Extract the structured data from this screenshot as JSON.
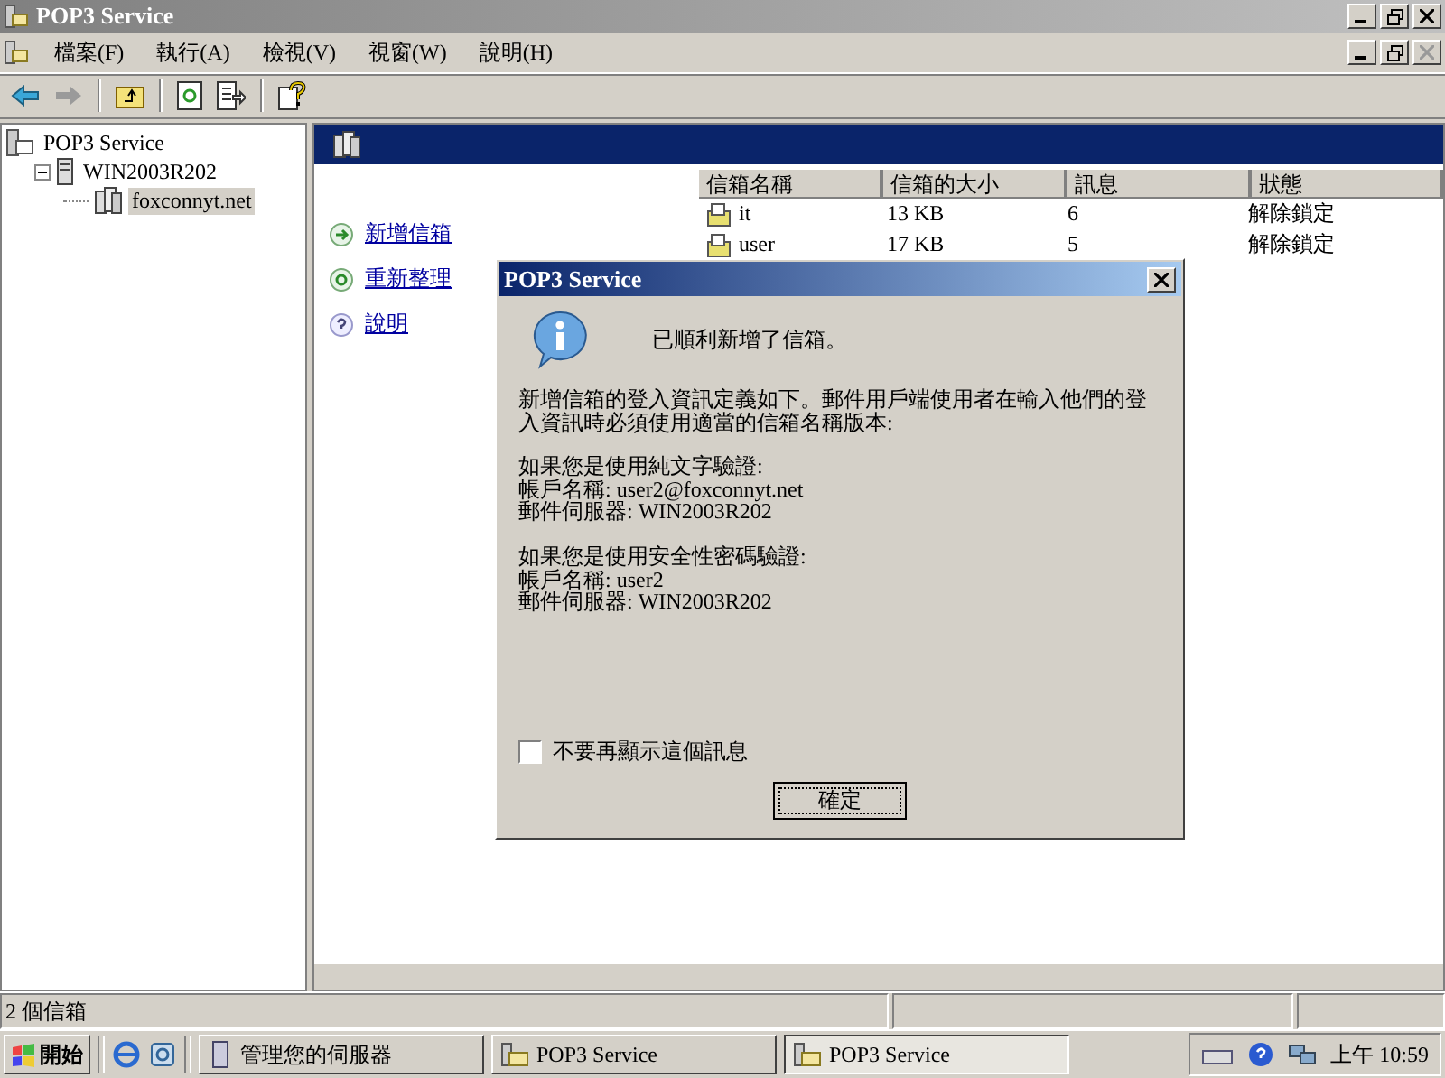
{
  "window": {
    "title": "POP3 Service"
  },
  "menu": [
    "檔案(F)",
    "執行(A)",
    "檢視(V)",
    "視窗(W)",
    "說明(H)"
  ],
  "tree": [
    {
      "label": "POP3 Service",
      "selected": false,
      "kind": "service",
      "children": [
        {
          "label": "WIN2003R202",
          "selected": false,
          "kind": "server",
          "expanded": true,
          "children": [
            {
              "label": "foxconnyt.net",
              "selected": true,
              "kind": "domain"
            }
          ]
        }
      ]
    }
  ],
  "actions": [
    {
      "label": "新增信箱",
      "kind": "add"
    },
    {
      "label": "重新整理",
      "kind": "refresh"
    },
    {
      "label": "說明",
      "kind": "help"
    }
  ],
  "table": {
    "columns": [
      "信箱名稱",
      "信箱的大小",
      "訊息",
      "狀態"
    ],
    "rows": [
      {
        "cells": [
          "it",
          "13 KB",
          "6",
          "解除鎖定"
        ]
      },
      {
        "cells": [
          "user",
          "17 KB",
          "5",
          "解除鎖定"
        ]
      }
    ]
  },
  "dialog": {
    "title": "POP3 Service",
    "heading": "已順利新增了信箱。",
    "sections": [
      [
        "新增信箱的登入資訊定義如下。郵件用戶端使用者在輸入他們的登入資訊時必須使用適當的信箱名稱版本:"
      ],
      [
        "如果您是使用純文字驗證:",
        "帳戶名稱: user2@foxconnyt.net",
        "郵件伺服器: WIN2003R202"
      ],
      [
        "如果您是使用安全性密碼驗證:",
        "帳戶名稱: user2",
        "郵件伺服器: WIN2003R202"
      ]
    ],
    "checkbox": {
      "label": "不要再顯示這個訊息",
      "checked": false
    },
    "button": "確定"
  },
  "status_bar": {
    "text": "2 個信箱"
  },
  "taskbar": {
    "start": "開始",
    "tasks": [
      {
        "label": "管理您的伺服器",
        "selected": false,
        "kind": "server"
      },
      {
        "label": "POP3 Service",
        "selected": false,
        "kind": "mail"
      },
      {
        "label": "POP3 Service",
        "selected": true,
        "kind": "mail"
      }
    ],
    "clock": "上午 10:59"
  }
}
